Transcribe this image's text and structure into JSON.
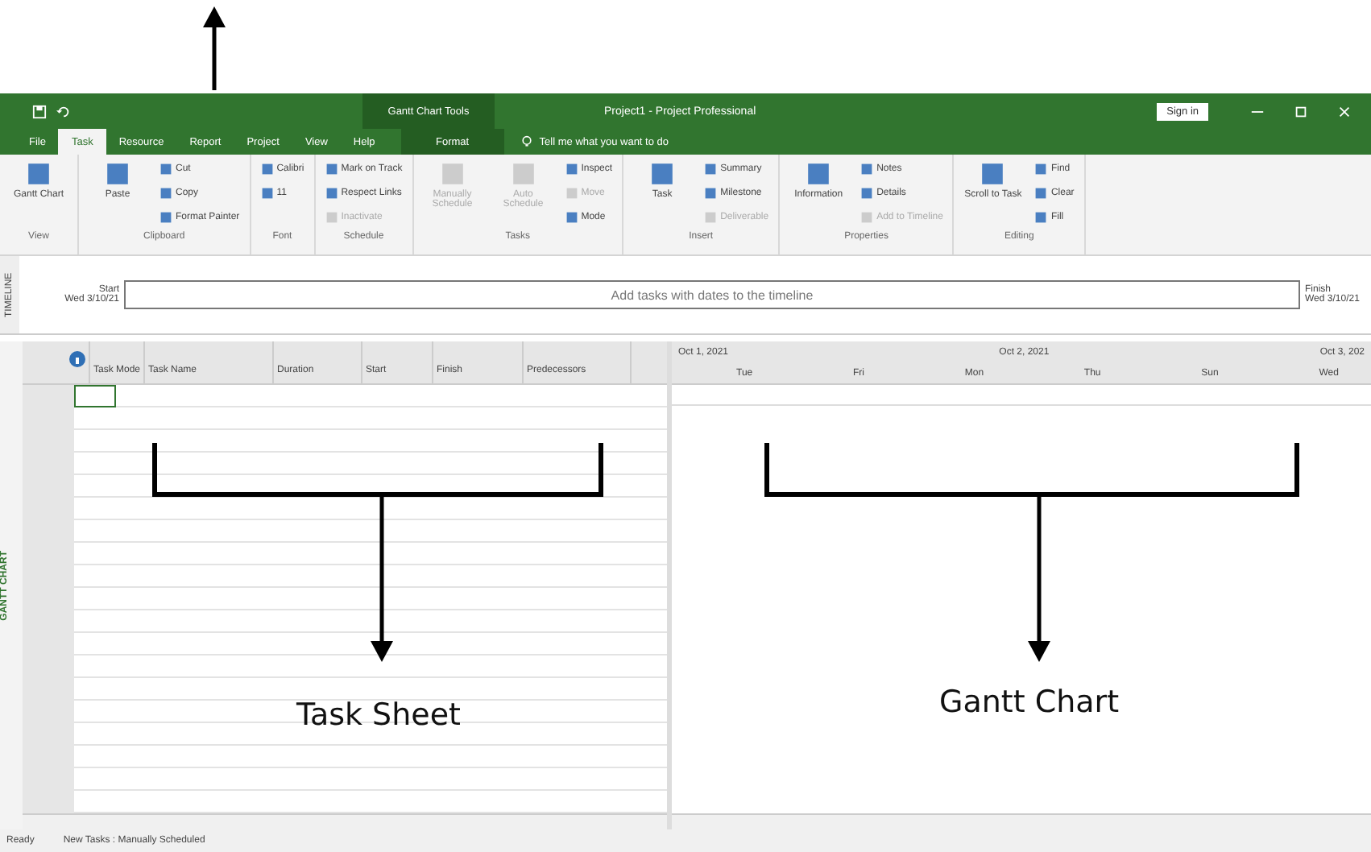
{
  "title_bar": {
    "contextual_label": "Gantt Chart Tools",
    "title": "Project1 - Project Professional",
    "sign_in": "Sign in"
  },
  "tabs": [
    {
      "label": "File",
      "selected": false
    },
    {
      "label": "Task",
      "selected": true
    },
    {
      "label": "Resource",
      "selected": false
    },
    {
      "label": "Report",
      "selected": false
    },
    {
      "label": "Project",
      "selected": false
    },
    {
      "label": "View",
      "selected": false
    },
    {
      "label": "Help",
      "selected": false
    },
    {
      "label": "Format",
      "selected": false
    }
  ],
  "tell_me": "Tell me what you want to do",
  "ribbon_groups": [
    {
      "label": "View",
      "items": [
        {
          "label": "Gantt Chart",
          "kind": "large",
          "disabled": false
        }
      ]
    },
    {
      "label": "Clipboard",
      "items": [
        {
          "label": "Paste",
          "kind": "large",
          "disabled": false
        },
        {
          "label": "Cut",
          "kind": "small",
          "disabled": false
        },
        {
          "label": "Copy",
          "kind": "small",
          "disabled": false
        },
        {
          "label": "Format Painter",
          "kind": "small",
          "disabled": false
        }
      ]
    },
    {
      "label": "Font",
      "items": [
        {
          "label": "Calibri",
          "kind": "small",
          "disabled": false
        },
        {
          "label": "11",
          "kind": "small",
          "disabled": false
        }
      ]
    },
    {
      "label": "Schedule",
      "items": [
        {
          "label": "Mark on Track",
          "kind": "small",
          "disabled": false
        },
        {
          "label": "Respect Links",
          "kind": "small",
          "disabled": false
        },
        {
          "label": "Inactivate",
          "kind": "small",
          "disabled": true
        }
      ]
    },
    {
      "label": "Tasks",
      "items": [
        {
          "label": "Manually Schedule",
          "kind": "large",
          "disabled": true
        },
        {
          "label": "Auto Schedule",
          "kind": "large",
          "disabled": true
        },
        {
          "label": "Inspect",
          "kind": "small",
          "disabled": false
        },
        {
          "label": "Move",
          "kind": "small",
          "disabled": true
        },
        {
          "label": "Mode",
          "kind": "small",
          "disabled": false
        }
      ]
    },
    {
      "label": "Insert",
      "items": [
        {
          "label": "Task",
          "kind": "large",
          "disabled": false
        },
        {
          "label": "Summary",
          "kind": "small",
          "disabled": false
        },
        {
          "label": "Milestone",
          "kind": "small",
          "disabled": false
        },
        {
          "label": "Deliverable",
          "kind": "small",
          "disabled": true
        }
      ]
    },
    {
      "label": "Properties",
      "items": [
        {
          "label": "Information",
          "kind": "large",
          "disabled": false
        },
        {
          "label": "Notes",
          "kind": "small",
          "disabled": false
        },
        {
          "label": "Details",
          "kind": "small",
          "disabled": false
        },
        {
          "label": "Add to Timeline",
          "kind": "small",
          "disabled": true
        }
      ]
    },
    {
      "label": "Editing",
      "items": [
        {
          "label": "Scroll to Task",
          "kind": "large",
          "disabled": false
        },
        {
          "label": "Find",
          "kind": "small",
          "disabled": false
        },
        {
          "label": "Clear",
          "kind": "small",
          "disabled": false
        },
        {
          "label": "Fill",
          "kind": "small",
          "disabled": false
        }
      ]
    }
  ],
  "timeline": {
    "side_label": "TIMELINE",
    "start_label": "Start",
    "start_date": "Wed 3/10/21",
    "placeholder": "Add tasks with dates to the timeline",
    "finish_label": "Finish",
    "finish_date": "Wed 3/10/21"
  },
  "table": {
    "columns": [
      "Task Mode",
      "Task Name",
      "Duration",
      "Start",
      "Finish",
      "Predecessors"
    ]
  },
  "gantt": {
    "side_label": "GANTT CHART",
    "weeks": [
      "Oct 1, 2021",
      "Oct 2, 2021",
      "Oct 3, 202"
    ],
    "days": [
      "Tue",
      "Fri",
      "Mon",
      "Thu",
      "Sun",
      "Wed"
    ]
  },
  "annotations": {
    "task_sheet": "Task Sheet",
    "gantt_chart": "Gantt Chart"
  },
  "status_bar": {
    "ready": "Ready",
    "task_mode": "New Tasks : Manually Scheduled"
  }
}
